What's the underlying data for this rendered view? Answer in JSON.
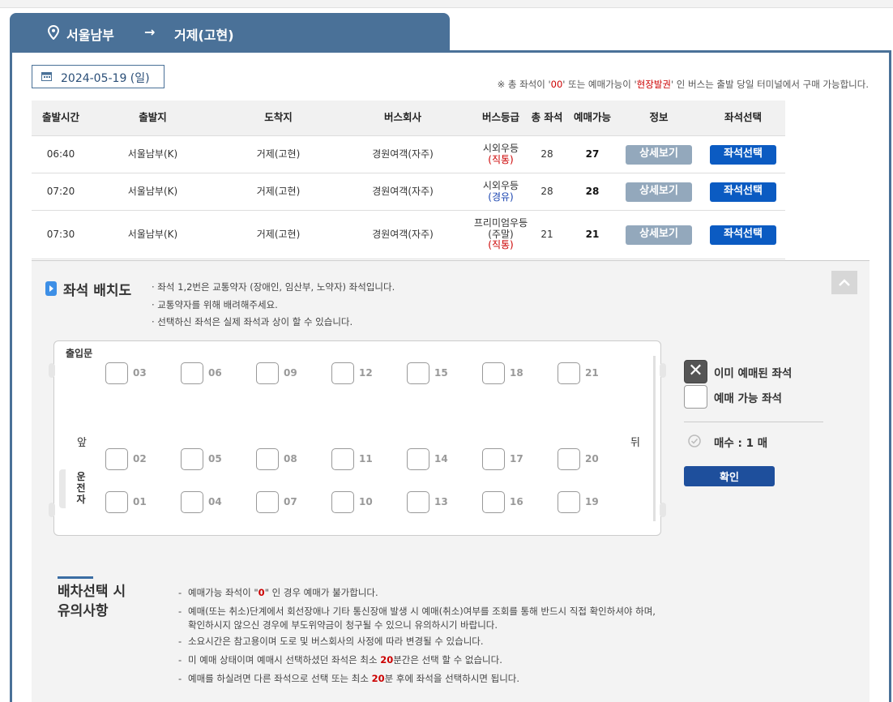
{
  "route": {
    "from": "서울남부",
    "arrow": "→",
    "to": "거제(고현)"
  },
  "date": "2024-05-19 (일)",
  "notice": {
    "pre": "※ 총 좌석이 '",
    "zero": "00",
    "mid": "' 또는 예매가능이 '",
    "onsite": "현장발권",
    "post": "' 인 버스는 출발 당일 터미널에서 구매 가능합니다."
  },
  "table": {
    "headers": [
      "출발시간",
      "출발지",
      "도착지",
      "버스회사",
      "버스등급",
      "총 좌석",
      "예매가능",
      "정보",
      "좌석선택"
    ],
    "rows": [
      {
        "time": "06:40",
        "from": "서울남부(K)",
        "to": "거제(고현)",
        "company": "경원여객(자주)",
        "grade": "시외우등",
        "grade2": "",
        "grade_sub": "(직통)",
        "sub_color": "red",
        "total": "28",
        "avail": "27",
        "info": "상세보기",
        "select": "좌석선택"
      },
      {
        "time": "07:20",
        "from": "서울남부(K)",
        "to": "거제(고현)",
        "company": "경원여객(자주)",
        "grade": "시외우등",
        "grade2": "",
        "grade_sub": "(경유)",
        "sub_color": "blue",
        "total": "28",
        "avail": "28",
        "info": "상세보기",
        "select": "좌석선택"
      },
      {
        "time": "07:30",
        "from": "서울남부(K)",
        "to": "거제(고현)",
        "company": "경원여객(자주)",
        "grade": "프리미엄우등",
        "grade2": "(주말)",
        "grade_sub": "(직통)",
        "sub_color": "red",
        "total": "21",
        "avail": "21",
        "info": "상세보기",
        "select": "좌석선택"
      }
    ]
  },
  "seat_map": {
    "title": "좌석 배치도",
    "notes": [
      "· 좌석 1,2번은 교통약자 (장애인, 임산부, 노약자) 좌석입니다.",
      "· 교통약자를 위해 배려해주세요.",
      "· 선택하신 좌석은 실제 좌석과 상이 할 수 있습니다."
    ],
    "door": "출입문",
    "front": "앞",
    "back": "뒤",
    "driver": "운전자",
    "rows": [
      [
        "03",
        "06",
        "09",
        "12",
        "15",
        "18",
        "21"
      ],
      [
        "02",
        "05",
        "08",
        "11",
        "14",
        "17",
        "20"
      ],
      [
        "01",
        "04",
        "07",
        "10",
        "13",
        "16",
        "19"
      ]
    ],
    "legend": {
      "booked_icon": "✕",
      "booked": "이미 예매된 좌석",
      "free": "예매 가능 좌석"
    },
    "count": "매수 : 1 매",
    "confirm": "확인"
  },
  "caution": {
    "title": "배차선택 시 유의사항",
    "items": {
      "a_pre": "예매가능 좌석이 \"",
      "a_zero": "0",
      "a_post": "\" 인 경우 예매가 불가합니다.",
      "b1": "예매(또는 취소)단계에서 회선장애나 기타 통신장애 발생 시 예매(취소)여부를 조회를 통해 반드시 직접 확인하셔야 하며,",
      "b2": "확인하시지 않으신 경우에 부도위약금이 청구될 수 있으니 유의하시기 바랍니다.",
      "c": "소요시간은 참고용이며 도로 및 버스회사의 사정에 따라 변경될 수 있습니다.",
      "d_pre": "미 예매 상태이며 예매시 선택하셨던 좌석은 최소 ",
      "d_num": "20",
      "d_post": "분간은 선택 할 수 없습니다.",
      "e_pre": "예매를 하실려면 다른 좌석으로 선택 또는 최소 ",
      "e_num": "20",
      "e_post": "분 후에 좌석을 선택하시면 됩니다."
    }
  },
  "colors": {
    "header_bg": "#4a7198",
    "primary_btn": "#0b5bc2",
    "info_btn": "#93a8bc",
    "confirm_btn": "#1e4f9c",
    "highlight": "#cc0000"
  }
}
